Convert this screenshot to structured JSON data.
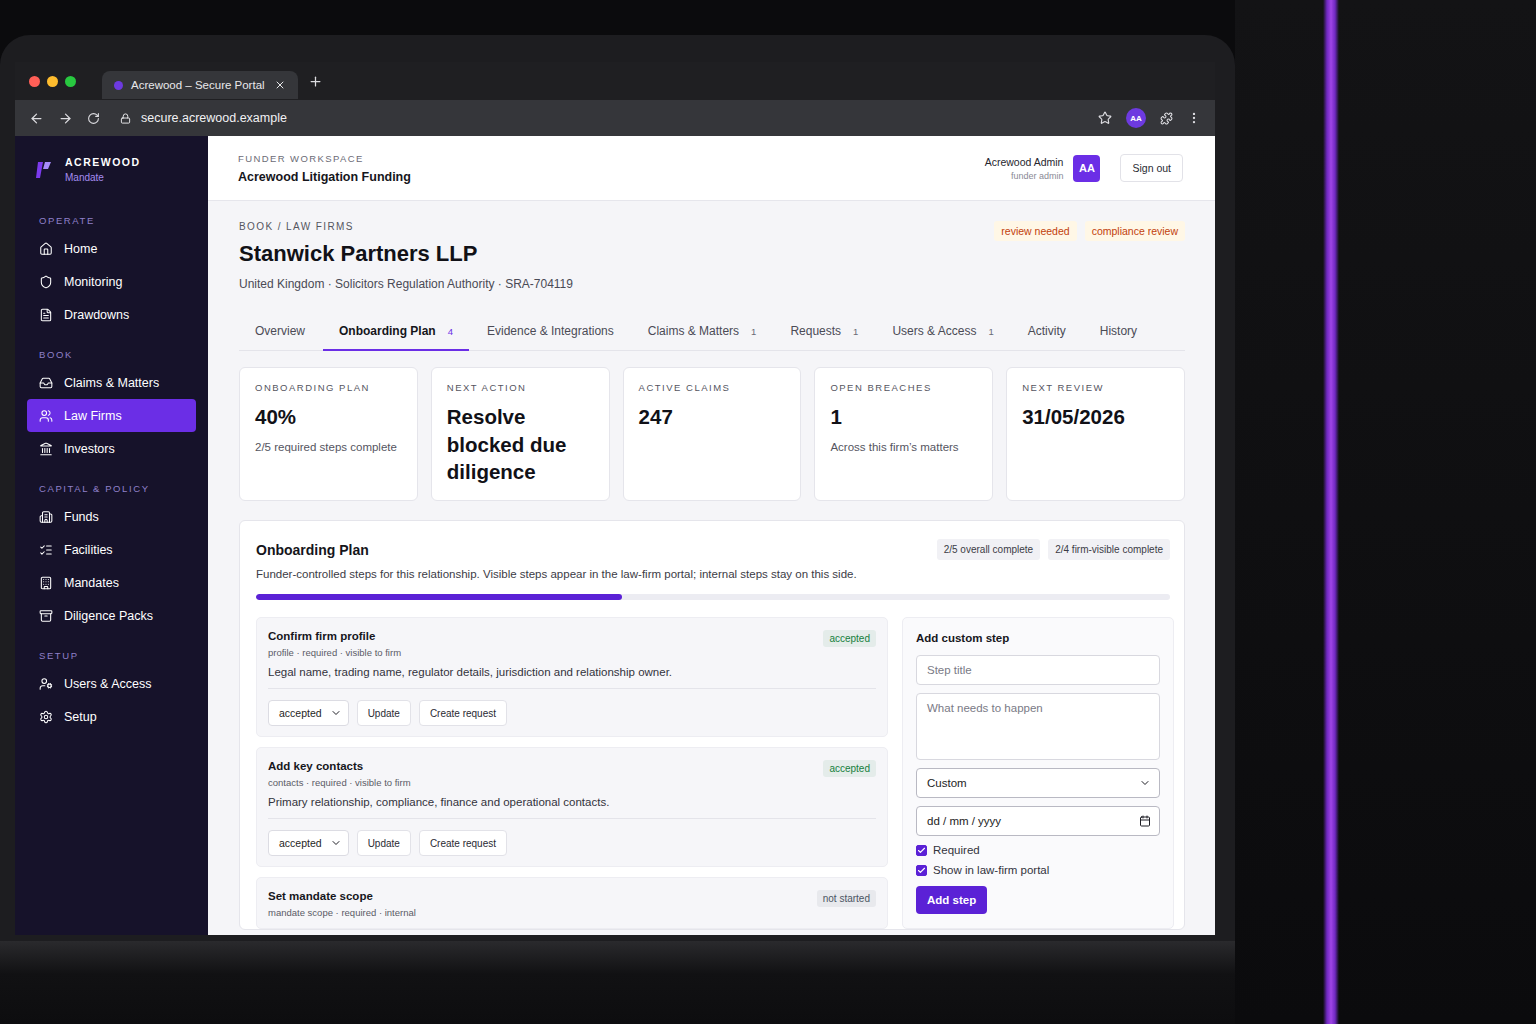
{
  "browser": {
    "tab_title": "Acrewood – Secure Portal",
    "address": "secure.acrewood.example",
    "profile": "AA"
  },
  "sidebar": {
    "brand": "ACREWOOD",
    "product": "Mandate",
    "sections": [
      {
        "title": "OPERATE",
        "items": [
          {
            "label": "Home",
            "selected": false
          },
          {
            "label": "Monitoring",
            "selected": false
          },
          {
            "label": "Drawdowns",
            "selected": false
          }
        ]
      },
      {
        "title": "BOOK",
        "items": [
          {
            "label": "Claims & Matters",
            "selected": false
          },
          {
            "label": "Law Firms",
            "selected": true
          },
          {
            "label": "Investors",
            "selected": false
          }
        ]
      },
      {
        "title": "CAPITAL & POLICY",
        "items": [
          {
            "label": "Funds",
            "selected": false
          },
          {
            "label": "Facilities",
            "selected": false
          },
          {
            "label": "Mandates",
            "selected": false
          },
          {
            "label": "Diligence Packs",
            "selected": false
          }
        ]
      },
      {
        "title": "SETUP",
        "items": [
          {
            "label": "Users & Access",
            "selected": false
          },
          {
            "label": "Setup",
            "selected": false
          }
        ]
      }
    ]
  },
  "header": {
    "eyebrow": "FUNDER WORKSPACE",
    "workspace": "Acrewood Litigation Funding",
    "user_name": "Acrewood Admin",
    "user_role": "funder admin",
    "avatar": "AA",
    "sign_out": "Sign out"
  },
  "breadcrumb": "BOOK / LAW FIRMS",
  "firm": {
    "name": "Stanwick Partners LLP",
    "details": "United Kingdom · Solicitors Regulation Authority · SRA-704119"
  },
  "badges": [
    {
      "label": "review needed"
    },
    {
      "label": "compliance review"
    }
  ],
  "tabs": [
    {
      "label": "Overview",
      "selected": false
    },
    {
      "label": "Onboarding Plan",
      "count": "4",
      "selected": true
    },
    {
      "label": "Evidence & Integrations",
      "selected": false
    },
    {
      "label": "Claims & Matters",
      "count": "1",
      "selected": false
    },
    {
      "label": "Requests",
      "count": "1",
      "selected": false
    },
    {
      "label": "Users & Access",
      "count": "1",
      "selected": false
    },
    {
      "label": "Activity",
      "selected": false
    },
    {
      "label": "History",
      "selected": false
    }
  ],
  "stats": [
    {
      "label": "ONBOARDING PLAN",
      "value": "40%",
      "note": "2/5 required steps complete"
    },
    {
      "label": "NEXT ACTION",
      "value": "Resolve blocked due diligence"
    },
    {
      "label": "ACTIVE CLAIMS",
      "value": "247"
    },
    {
      "label": "OPEN BREACHES",
      "value": "1",
      "note": "Across this firm’s matters"
    },
    {
      "label": "NEXT REVIEW",
      "value": "31/05/2026"
    }
  ],
  "plan": {
    "title": "Onboarding Plan",
    "chips": [
      "2/5 overall complete",
      "2/4 firm-visible complete"
    ],
    "description": "Funder-controlled steps for this relationship. Visible steps appear in the law-firm portal; internal steps stay on this side.",
    "level": 0.4,
    "steps": [
      {
        "title": "Confirm firm profile",
        "meta": "profile · required · visible to firm",
        "status": "accepted",
        "color": "#15803d",
        "description": "Legal name, trading name, regulator details, jurisdiction and relationship owner.",
        "select": "accepted",
        "actions": [
          "Update",
          "Create request"
        ]
      },
      {
        "title": "Add key contacts",
        "meta": "contacts · required · visible to firm",
        "status": "accepted",
        "color": "#15803d",
        "description": "Primary relationship, compliance, finance and operational contacts.",
        "select": "accepted",
        "actions": [
          "Update",
          "Create request"
        ]
      },
      {
        "title": "Set mandate scope",
        "meta": "mandate scope · required · internal",
        "status": "not started",
        "color": "#4b5563"
      }
    ]
  },
  "form": {
    "title": "Add custom step",
    "title_placeholder": "Step title",
    "body_placeholder": "What needs to happen",
    "type": "Custom",
    "date_placeholder": "dd / mm / yyyy",
    "checkboxes": [
      {
        "label": "Required",
        "checked": true
      },
      {
        "label": "Show in law-firm portal",
        "checked": true
      }
    ],
    "submit": "Add step"
  }
}
